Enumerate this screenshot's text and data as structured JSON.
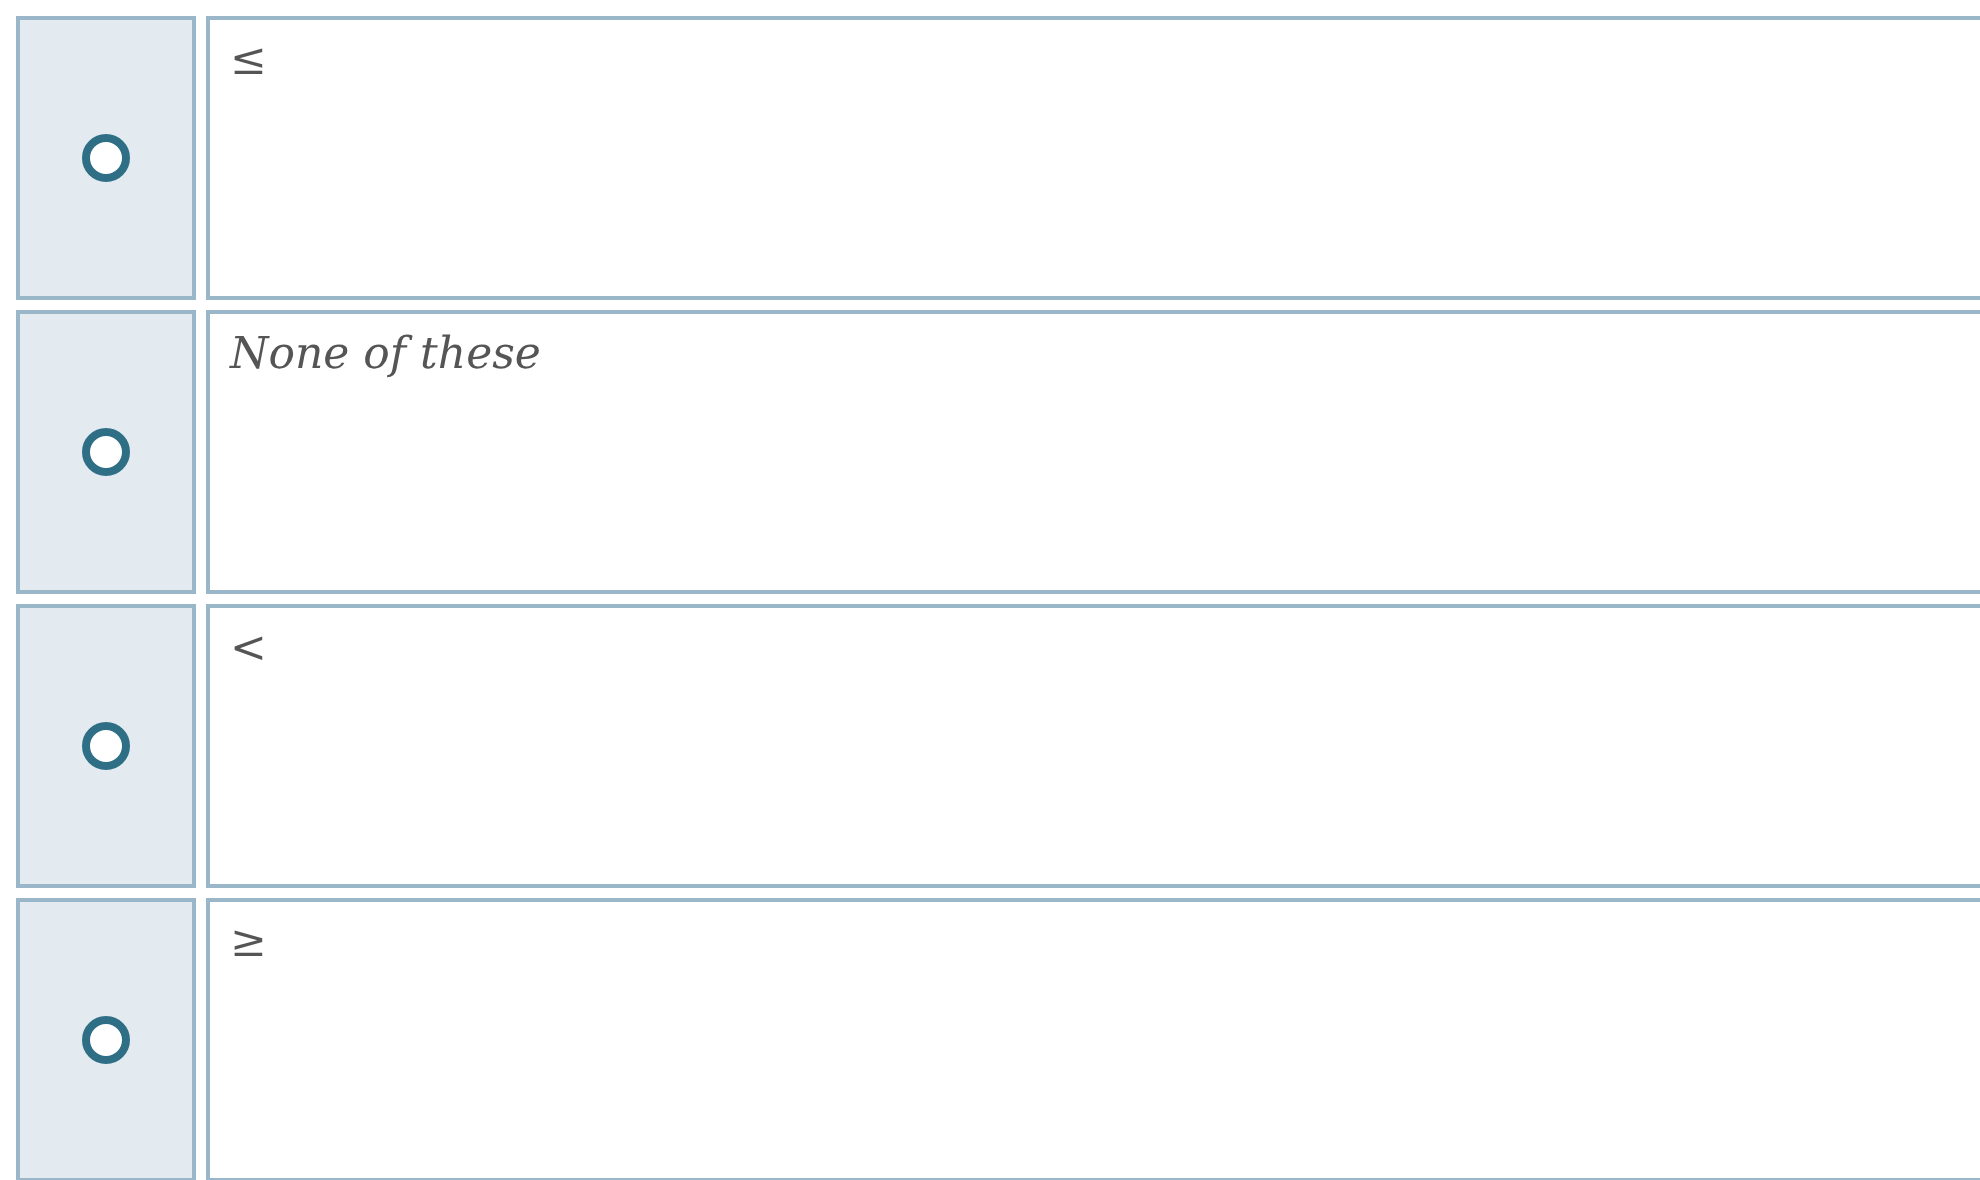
{
  "options": [
    {
      "text": "≤",
      "selected": false
    },
    {
      "text": "None of these",
      "selected": false
    },
    {
      "text": "<",
      "selected": false
    },
    {
      "text": "≥",
      "selected": false
    }
  ]
}
